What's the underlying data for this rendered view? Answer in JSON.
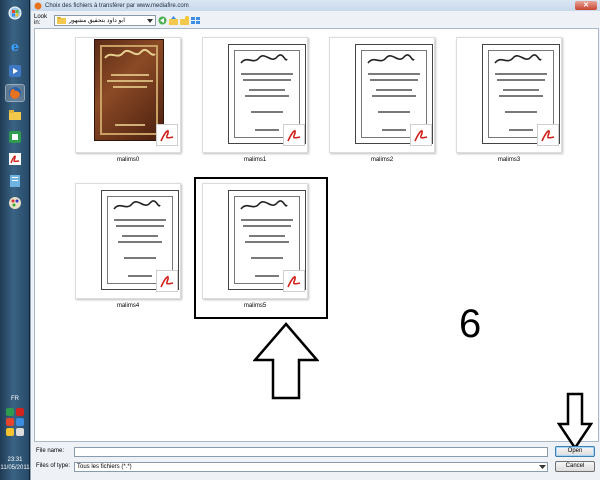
{
  "dialog": {
    "title": "Choix des fichiers à transférer par www.mediafire.com",
    "look_in_label": "Look in:",
    "look_in_value": "ابو داود بتحقيق مشهور"
  },
  "files": [
    {
      "name": "malims0",
      "kind": "cover"
    },
    {
      "name": "malims1",
      "kind": "page"
    },
    {
      "name": "malims2",
      "kind": "page"
    },
    {
      "name": "malims3",
      "kind": "page"
    },
    {
      "name": "malims4",
      "kind": "page"
    },
    {
      "name": "malims5",
      "kind": "page",
      "selected": true
    }
  ],
  "bottom": {
    "file_name_label": "File name:",
    "file_name_value": "",
    "file_type_label": "Files of type:",
    "file_type_value": "Tous les fichiers (*.*)",
    "open_label": "Open",
    "cancel_label": "Cancel"
  },
  "annotation": {
    "step_number": "6"
  },
  "taskbar": {
    "language": "FR",
    "time": "23:31",
    "date": "11/05/2011"
  },
  "colors": {
    "pdf_red": "#d2231d",
    "taskbar": "#2b4e6d",
    "accent": "#3c7fb1"
  }
}
